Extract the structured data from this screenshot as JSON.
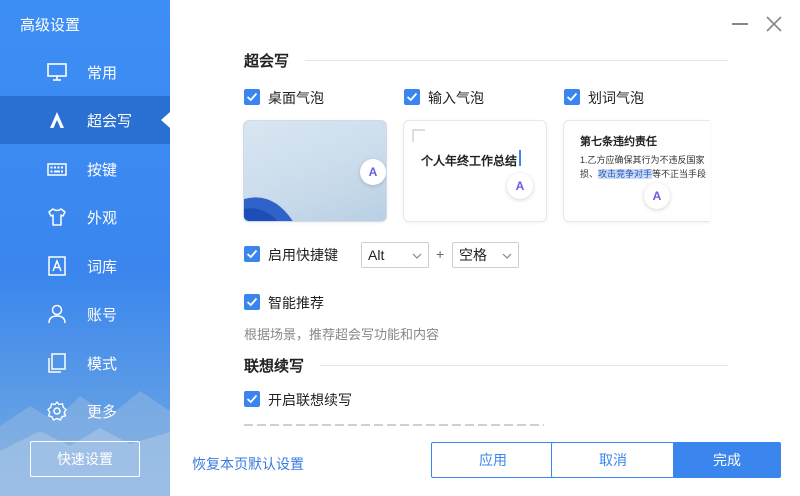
{
  "sidebar": {
    "title": "高级设置",
    "items": [
      {
        "label": "常用",
        "icon": "monitor-icon"
      },
      {
        "label": "超会写",
        "icon": "ai-write-icon"
      },
      {
        "label": "按键",
        "icon": "keyboard-icon"
      },
      {
        "label": "外观",
        "icon": "tshirt-icon"
      },
      {
        "label": "词库",
        "icon": "lexicon-icon"
      },
      {
        "label": "账号",
        "icon": "user-icon"
      },
      {
        "label": "模式",
        "icon": "mode-icon"
      },
      {
        "label": "更多",
        "icon": "gear-icon"
      }
    ],
    "active_index": 1,
    "quick_button": "快速设置"
  },
  "main": {
    "section1_title": "超会写",
    "bubbles": [
      {
        "label": "桌面气泡",
        "checked": true
      },
      {
        "label": "输入气泡",
        "checked": true
      },
      {
        "label": "划词气泡",
        "checked": true
      }
    ],
    "preview2_text": "个人年终工作总结",
    "preview3": {
      "title": "第七条违约责任",
      "line1": "1.乙方应确保其行为不违反国家",
      "line2_prefix": "损、",
      "line2_highlight": "攻击竞争对手",
      "line2_suffix": "等不正当手段"
    },
    "bubble_letter": "A",
    "hotkey": {
      "label": "启用快捷键",
      "checked": true,
      "modifier": "Alt",
      "plus": "+",
      "key": "空格"
    },
    "smart": {
      "label": "智能推荐",
      "checked": true,
      "hint": "根据场景，推荐超会写功能和内容"
    },
    "section2_title": "联想续写",
    "continue": {
      "label": "开启联想续写",
      "checked": true
    }
  },
  "footer": {
    "restore": "恢复本页默认设置",
    "apply": "应用",
    "cancel": "取消",
    "done": "完成"
  },
  "colors": {
    "accent": "#3a86ee",
    "sidebar_active": "#2a6fd2"
  }
}
